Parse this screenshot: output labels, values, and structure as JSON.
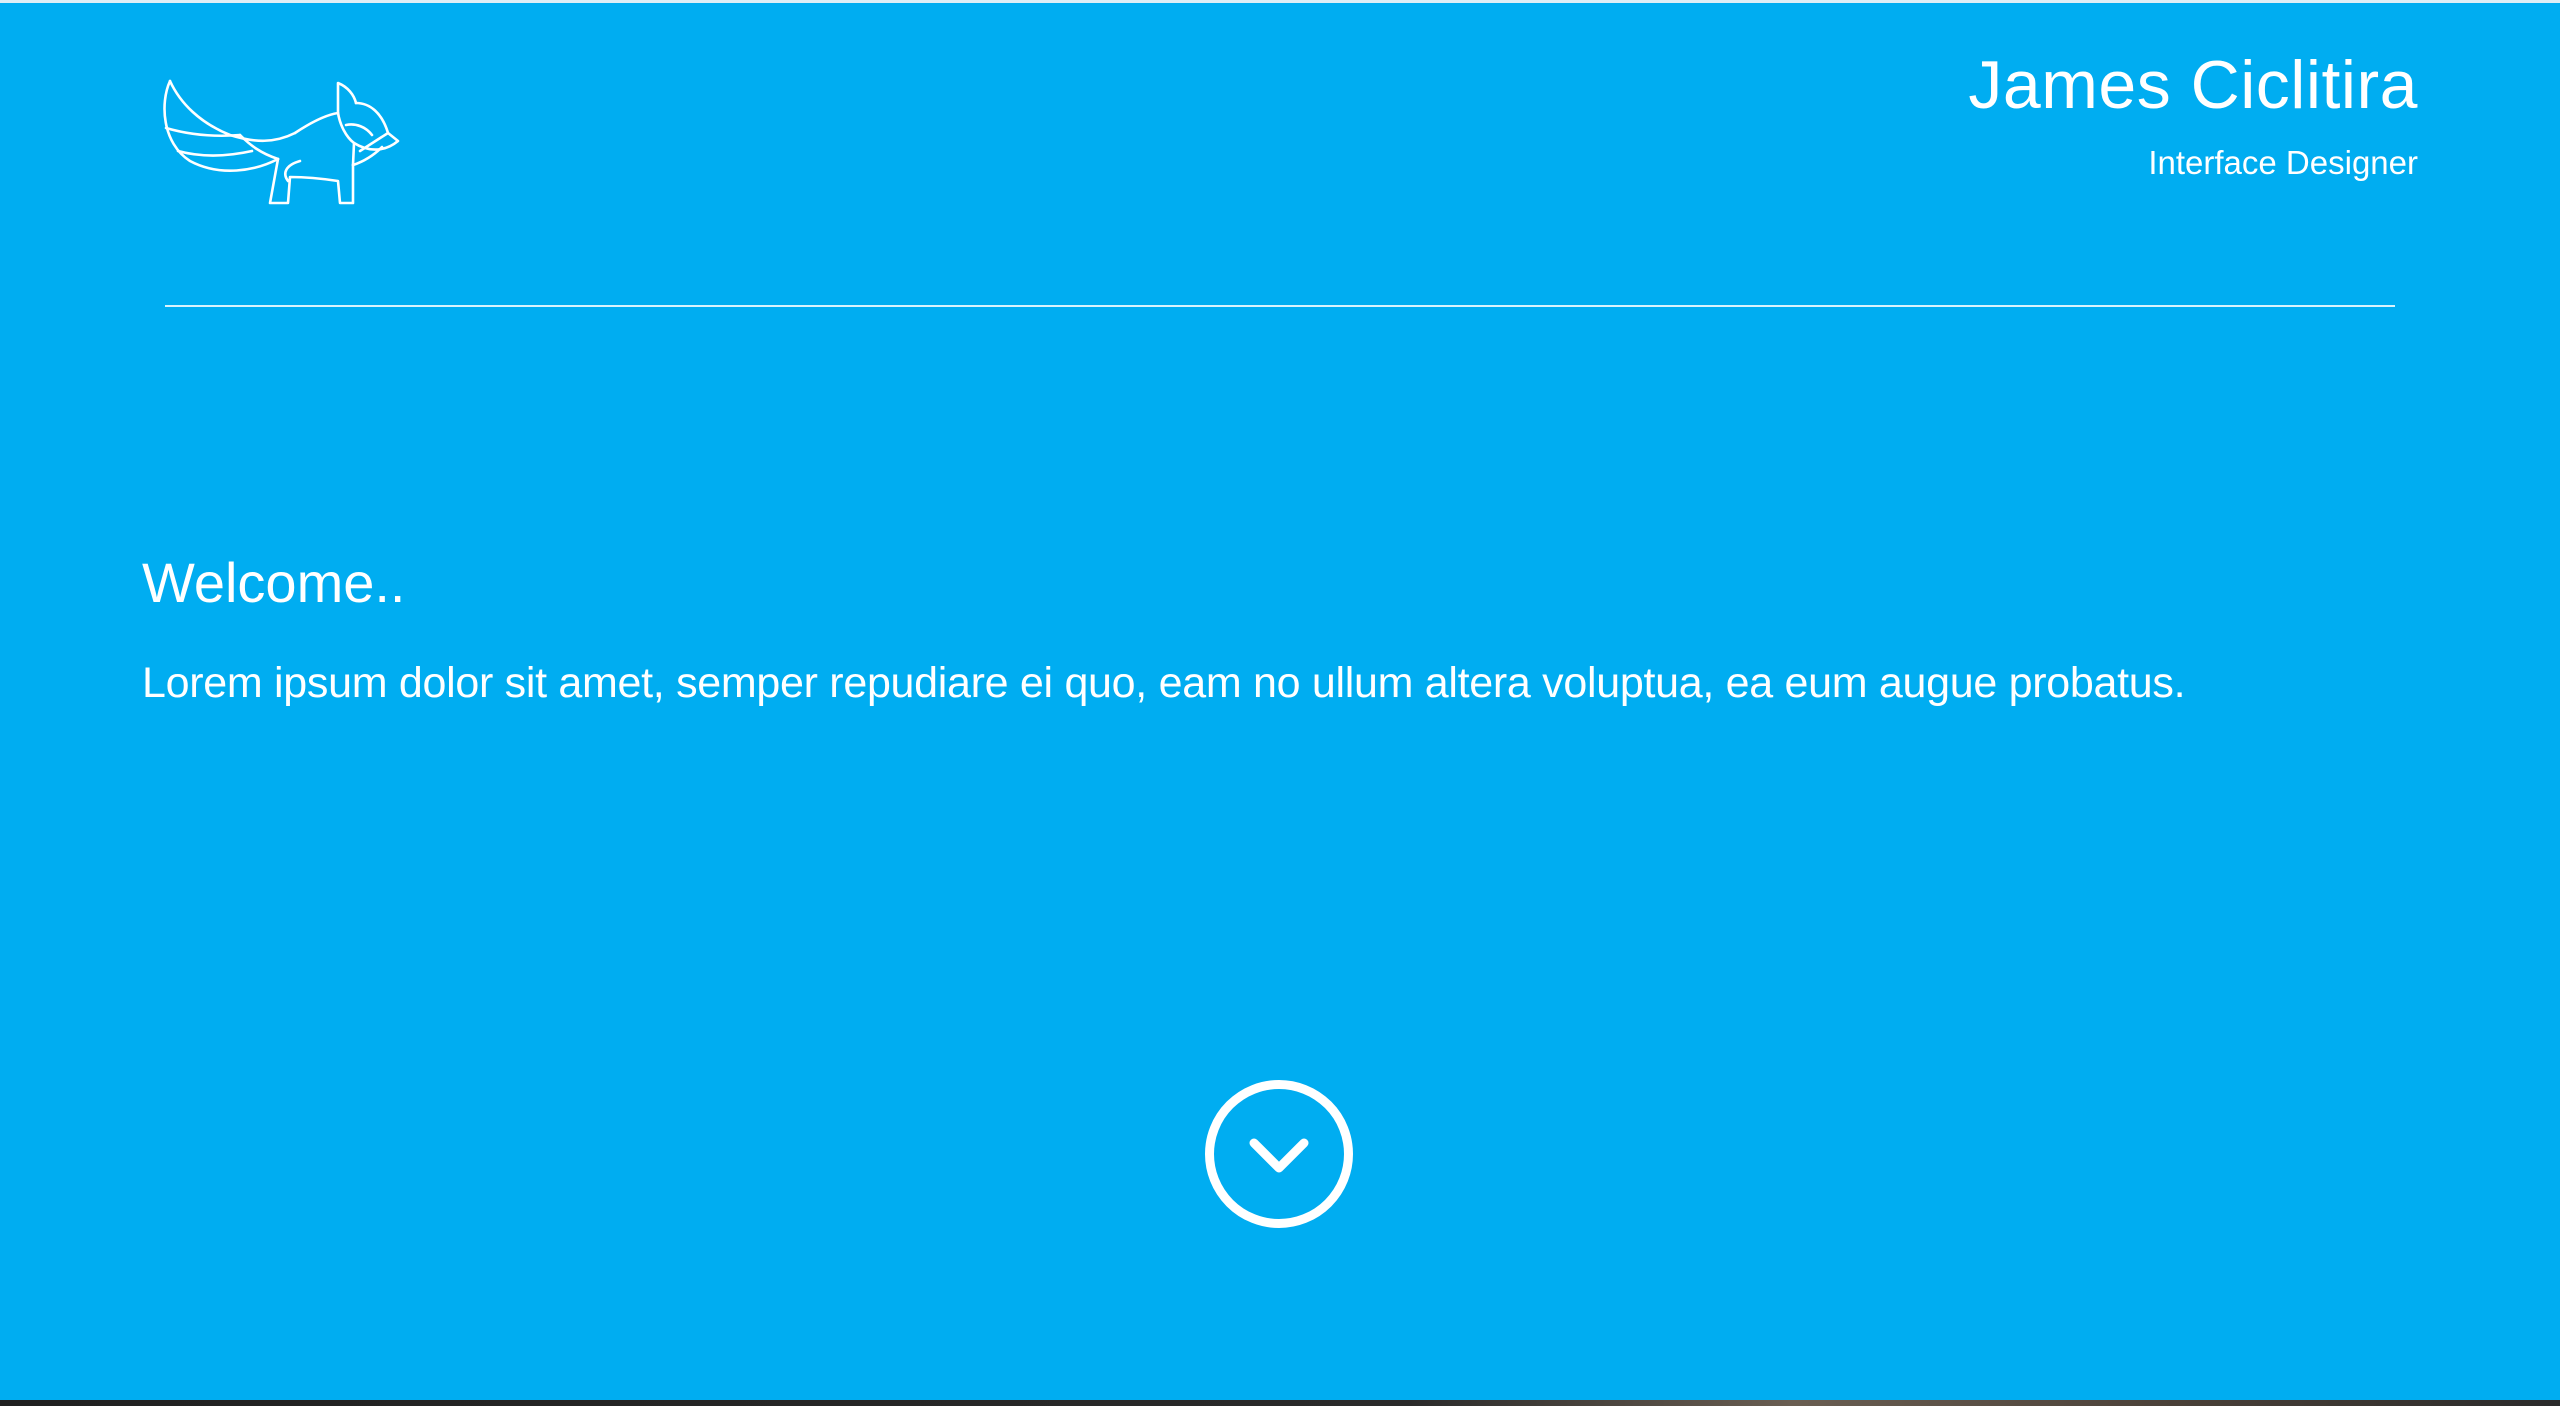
{
  "header": {
    "logo_icon": "fox-line-art-icon",
    "name": "James Ciclitira",
    "role": "Interface Designer"
  },
  "hero": {
    "heading": "Welcome..",
    "intro": "Lorem ipsum dolor sit amet, semper repudiare ei quo, eam no ullum altera voluptua, ea eum augue probatus."
  },
  "scroll_button": {
    "icon": "chevron-down-icon"
  },
  "colors": {
    "background": "#00adf1",
    "foreground": "#ffffff"
  }
}
